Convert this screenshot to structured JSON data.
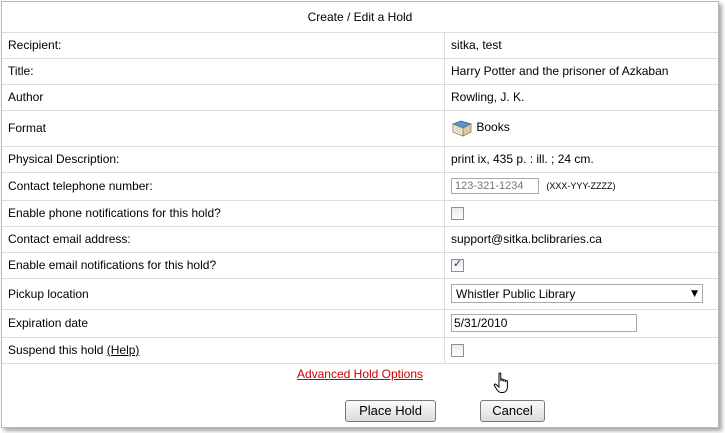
{
  "dialog": {
    "title": "Create / Edit a Hold"
  },
  "fields": {
    "recipient": {
      "label": "Recipient:",
      "value": "sitka, test"
    },
    "title": {
      "label": "Title:",
      "value": "Harry Potter and the prisoner of Azkaban"
    },
    "author": {
      "label": "Author",
      "value": "Rowling, J. K."
    },
    "format": {
      "label": "Format",
      "value": "Books",
      "icon": "book-icon"
    },
    "physical": {
      "label": "Physical Description:",
      "value": "print ix, 435 p. : ill. ; 24 cm."
    },
    "phone": {
      "label": "Contact telephone number:",
      "placeholder": "123-321-1234",
      "format_hint": "(XXX-YYY-ZZZZ)"
    },
    "phone_notify": {
      "label": "Enable phone notifications for this hold?",
      "checked": false
    },
    "email": {
      "label": "Contact email address:",
      "value": "support@sitka.bclibraries.ca"
    },
    "email_notify": {
      "label": "Enable email notifications for this hold?",
      "checked": true
    },
    "pickup": {
      "label": "Pickup location",
      "selected": "Whistler Public Library"
    },
    "expiration": {
      "label": "Expiration date",
      "value": "5/31/2010"
    },
    "suspend": {
      "label": "Suspend this hold",
      "help_link": "(Help)",
      "checked": false
    }
  },
  "advanced_link": "Advanced Hold Options",
  "buttons": {
    "place_hold": "Place Hold",
    "cancel": "Cancel"
  }
}
